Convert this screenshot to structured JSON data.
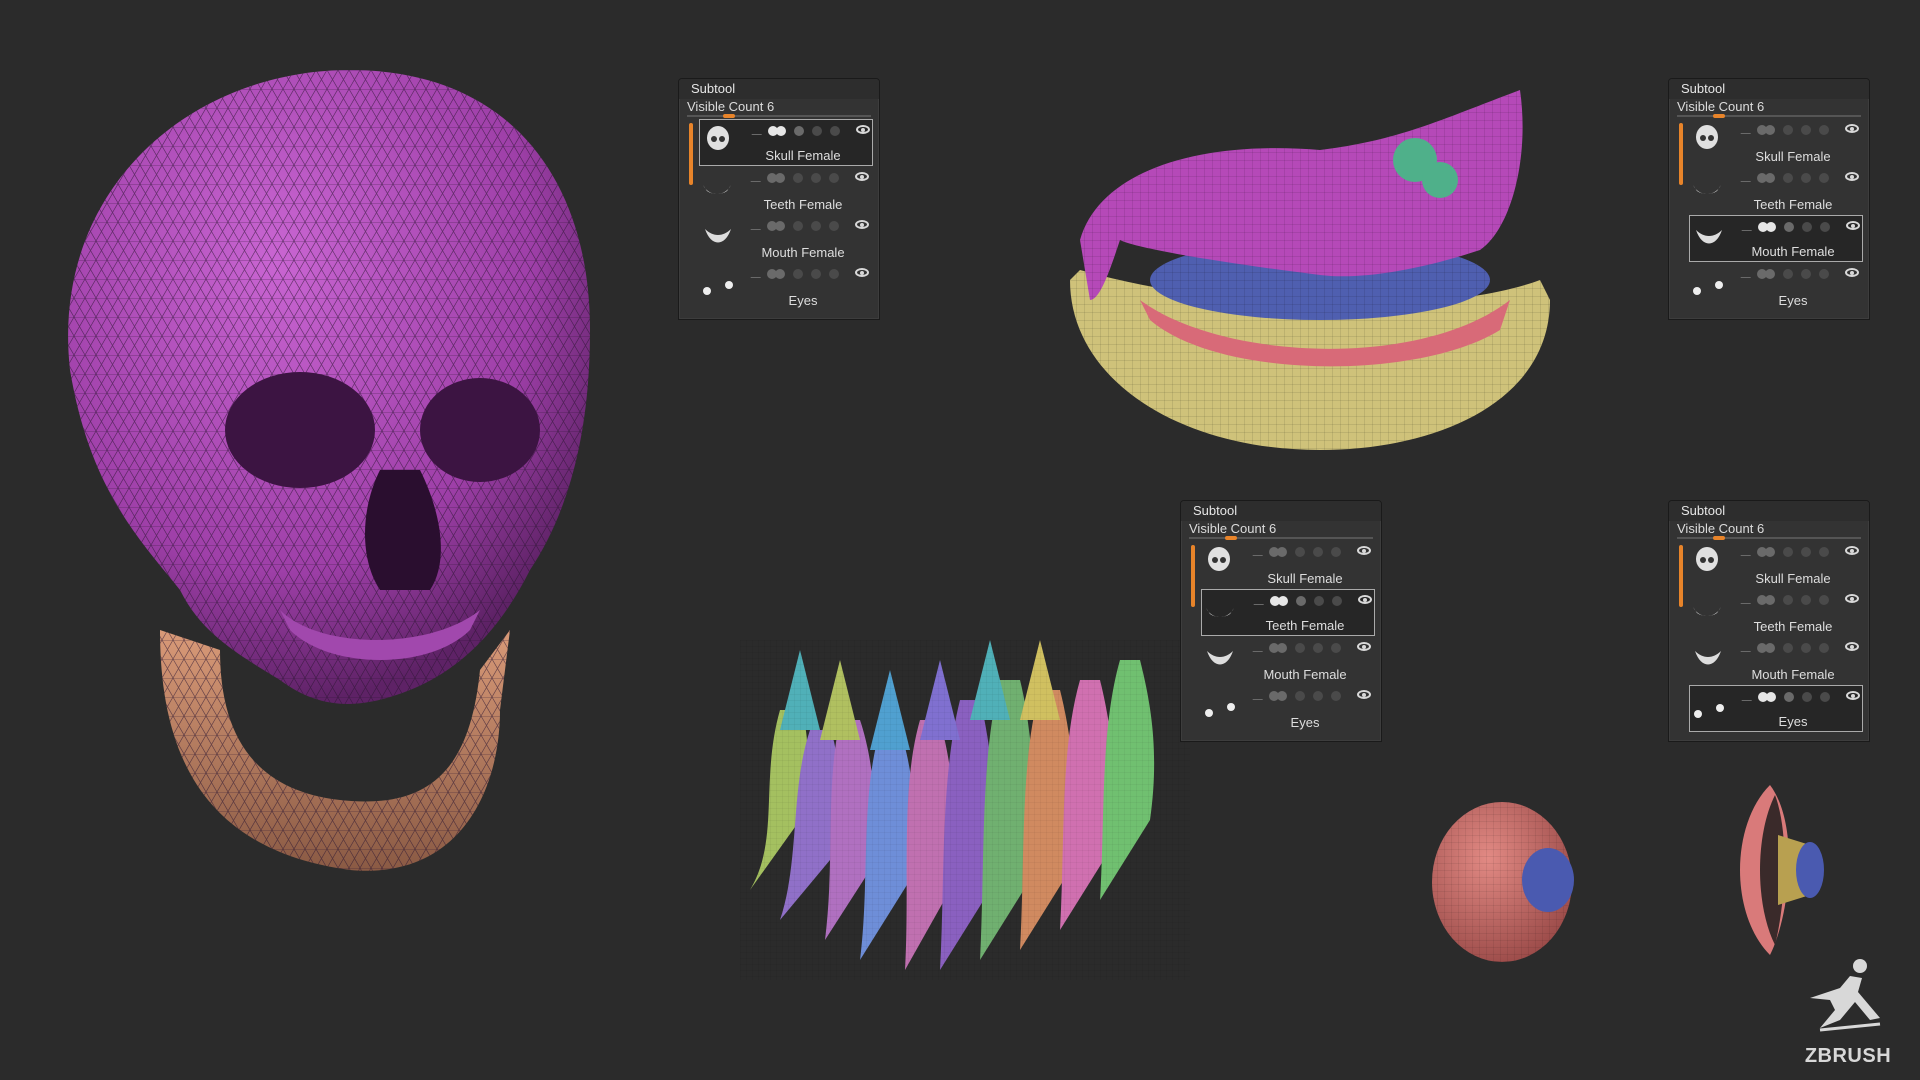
{
  "panels": [
    {
      "title": "Subtool",
      "visible_label": "Visible Count",
      "visible_count": "6",
      "selected": 0,
      "items": [
        "Skull Female",
        "Teeth Female",
        "Mouth Female",
        "Eyes"
      ]
    },
    {
      "title": "Subtool",
      "visible_label": "Visible Count",
      "visible_count": "6",
      "selected": 2,
      "items": [
        "Skull Female",
        "Teeth Female",
        "Mouth Female",
        "Eyes"
      ]
    },
    {
      "title": "Subtool",
      "visible_label": "Visible Count",
      "visible_count": "6",
      "selected": 1,
      "items": [
        "Skull Female",
        "Teeth Female",
        "Mouth Female",
        "Eyes"
      ]
    },
    {
      "title": "Subtool",
      "visible_label": "Visible Count",
      "visible_count": "6",
      "selected": 3,
      "items": [
        "Skull Female",
        "Teeth Female",
        "Mouth Female",
        "Eyes"
      ]
    }
  ],
  "logo": {
    "text": "ZBRUSH"
  },
  "colors": {
    "background": "#2b2b2b",
    "skull": "#b44fbc",
    "jaw": "#c88a6a",
    "accent": "#e8842a"
  }
}
